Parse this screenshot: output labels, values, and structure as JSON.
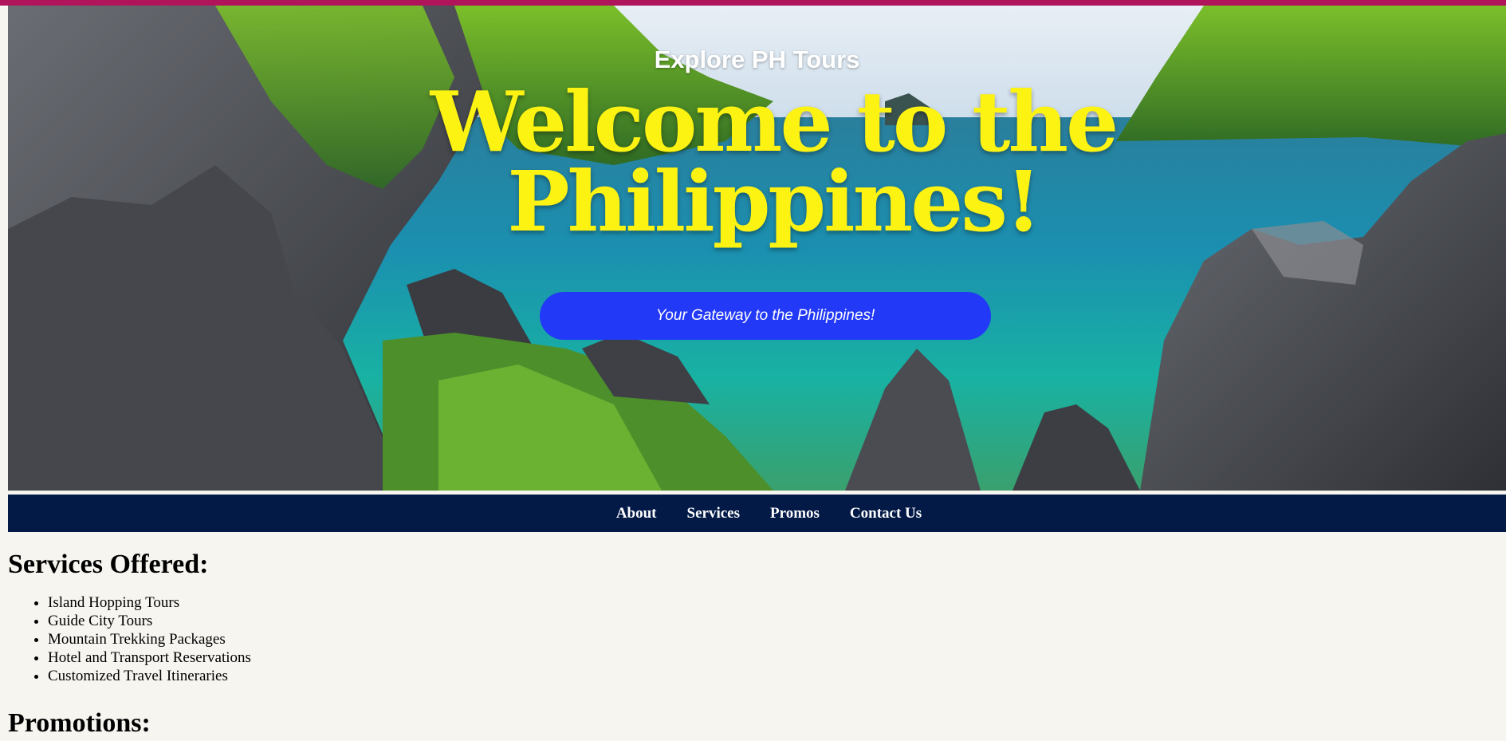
{
  "hero": {
    "subtitle": "Explore PH Tours",
    "title_line1": "Welcome to the",
    "title_line2": "Philippines!",
    "button_label": "Your Gateway to the Philippines!",
    "title_color": "#fdf313",
    "button_color": "#2239f8"
  },
  "nav": {
    "items": [
      {
        "label": "About"
      },
      {
        "label": "Services"
      },
      {
        "label": "Promos"
      },
      {
        "label": "Contact Us"
      }
    ],
    "background": "#031a47"
  },
  "services": {
    "heading": "Services Offered:",
    "items": [
      "Island Hopping Tours",
      "Guide City Tours",
      "Mountain Trekking Packages",
      "Hotel and Transport Reservations",
      "Customized Travel Itineraries"
    ]
  },
  "promotions": {
    "heading": "Promotions:"
  },
  "colors": {
    "accent_bar": "#b0155c",
    "page_background": "#f6f5f0"
  }
}
